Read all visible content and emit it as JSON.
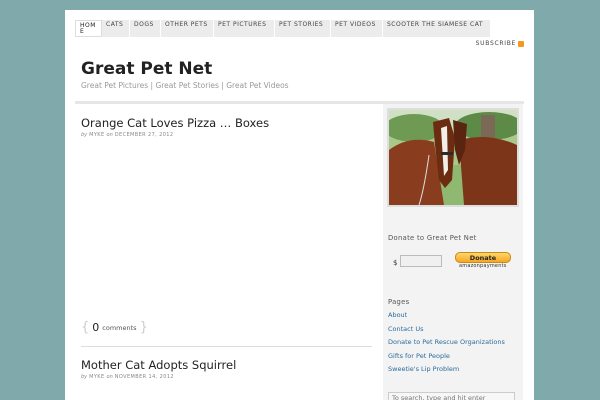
{
  "nav": {
    "items": [
      {
        "label": "Home",
        "active": true
      },
      {
        "label": "Cats",
        "active": false
      },
      {
        "label": "Dogs",
        "active": false
      },
      {
        "label": "Other Pets",
        "active": false
      },
      {
        "label": "Pet Pictures",
        "active": false
      },
      {
        "label": "Pet Stories",
        "active": false
      },
      {
        "label": "Pet Videos",
        "active": false
      },
      {
        "label": "Scooter the Siamese Cat",
        "active": false
      }
    ],
    "subscribe": "SUBSCRIBE"
  },
  "site": {
    "title": "Great Pet Net",
    "description": "Great Pet Pictures | Great Pet Stories | Great Pet Videos"
  },
  "posts": [
    {
      "title": "Orange Cat Loves Pizza … Boxes",
      "by": "by",
      "author": "MYKE",
      "on": "on",
      "date": "DECEMBER 27, 2012"
    },
    {
      "title": "Mother Cat Adopts Squirrel",
      "by": "by",
      "author": "MYKE",
      "on": "on",
      "date": "NOVEMBER 14, 2012"
    }
  ],
  "comments": {
    "count": "0",
    "label": "comments"
  },
  "sidebar": {
    "donate_title": "Donate to Great Pet Net",
    "currency": "$",
    "donate_button": "Donate",
    "donate_provider": "amazonpayments",
    "pages_title": "Pages",
    "pages": [
      "About",
      "Contact Us",
      "Donate to Pet Rescue Organizations",
      "Gifts for Pet People",
      "Sweetie's Lip Problem"
    ],
    "search_placeholder": "To search, type and hit enter"
  },
  "colors": {
    "background": "#7fa9ab",
    "link": "#2a6b9c",
    "rss": "#f39a1d"
  }
}
